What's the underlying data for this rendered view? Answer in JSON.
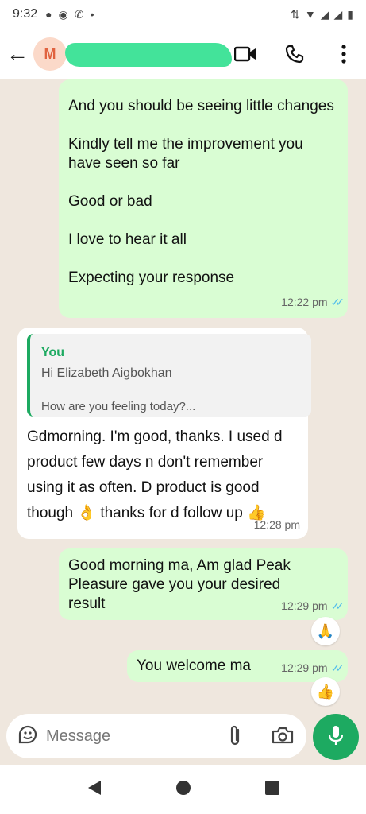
{
  "status": {
    "time": "9:32"
  },
  "header": {
    "avatar_letter": "M"
  },
  "messages": {
    "m1": {
      "lines": [
        "And you should be seeing little changes",
        "Kindly tell me the improvement you have seen so far",
        "Good or bad",
        "I love to hear it all",
        "Expecting your response"
      ],
      "time": "12:22 pm"
    },
    "m2": {
      "quote_author": "You",
      "quote_line1": "Hi  Elizabeth Aigbokhan",
      "quote_line2": "How are you feeling today?...",
      "text": "Gdmorning.  I'm good, thanks. I used d product few  days n don't remember using it as often.  D product is good though 👌 thanks for d follow up 👍",
      "time": "12:28 pm"
    },
    "m3": {
      "text": "Good morning ma, Am glad Peak Pleasure  gave you your desired result",
      "time": "12:29 pm",
      "reaction": "🙏"
    },
    "m4": {
      "text": "You welcome ma",
      "time": "12:29 pm",
      "reaction": "👍"
    }
  },
  "composer": {
    "placeholder": "Message"
  },
  "colors": {
    "accent": "#1daa61",
    "outgoing_bubble": "#d9fdd3",
    "read_ticks": "#53bdeb"
  }
}
